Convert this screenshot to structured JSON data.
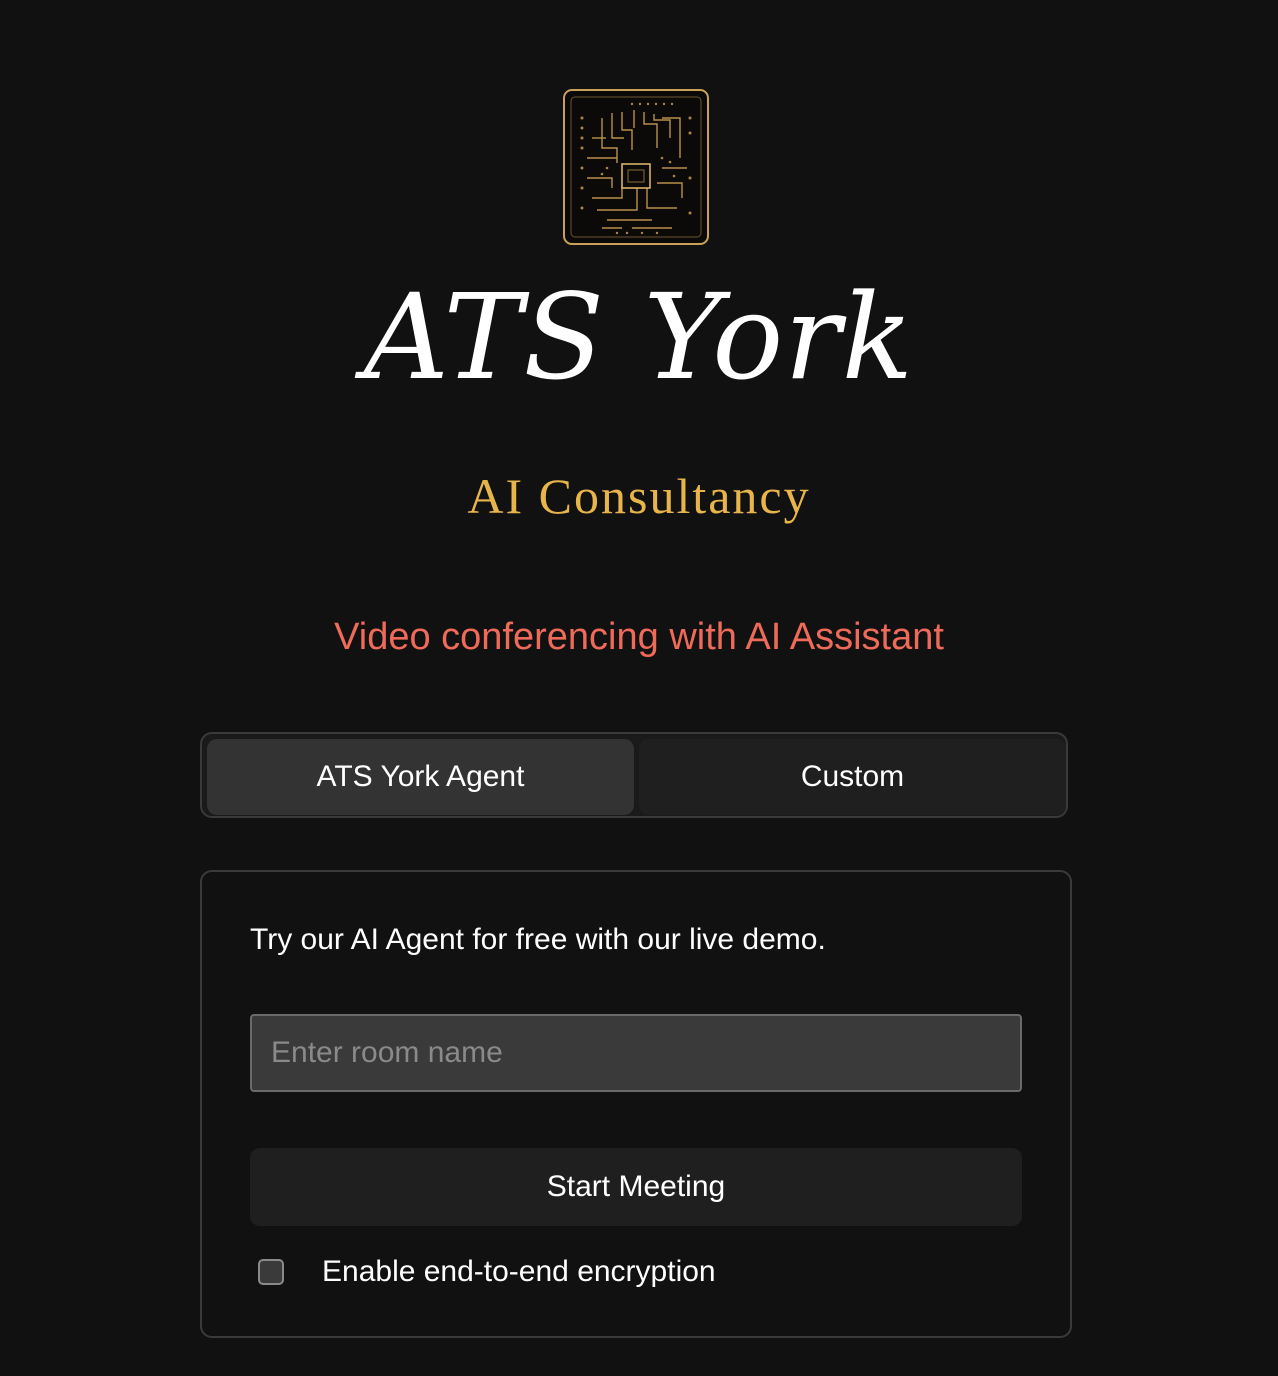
{
  "brand": {
    "title": "ATS York",
    "subtitle": "AI Consultancy",
    "logo_icon": "circuit-chip-icon",
    "gold_color": "#e8b54a"
  },
  "tagline": "Video conferencing with AI Assistant",
  "tagline_color": "#ee6b5a",
  "tabs": [
    {
      "label": "ATS York Agent",
      "active": true
    },
    {
      "label": "Custom",
      "active": false
    }
  ],
  "card": {
    "intro": "Try our AI Agent for free with our live demo.",
    "room_input": {
      "placeholder": "Enter room name",
      "value": ""
    },
    "start_button": "Start Meeting",
    "e2ee": {
      "label": "Enable end-to-end encryption",
      "checked": false
    }
  }
}
